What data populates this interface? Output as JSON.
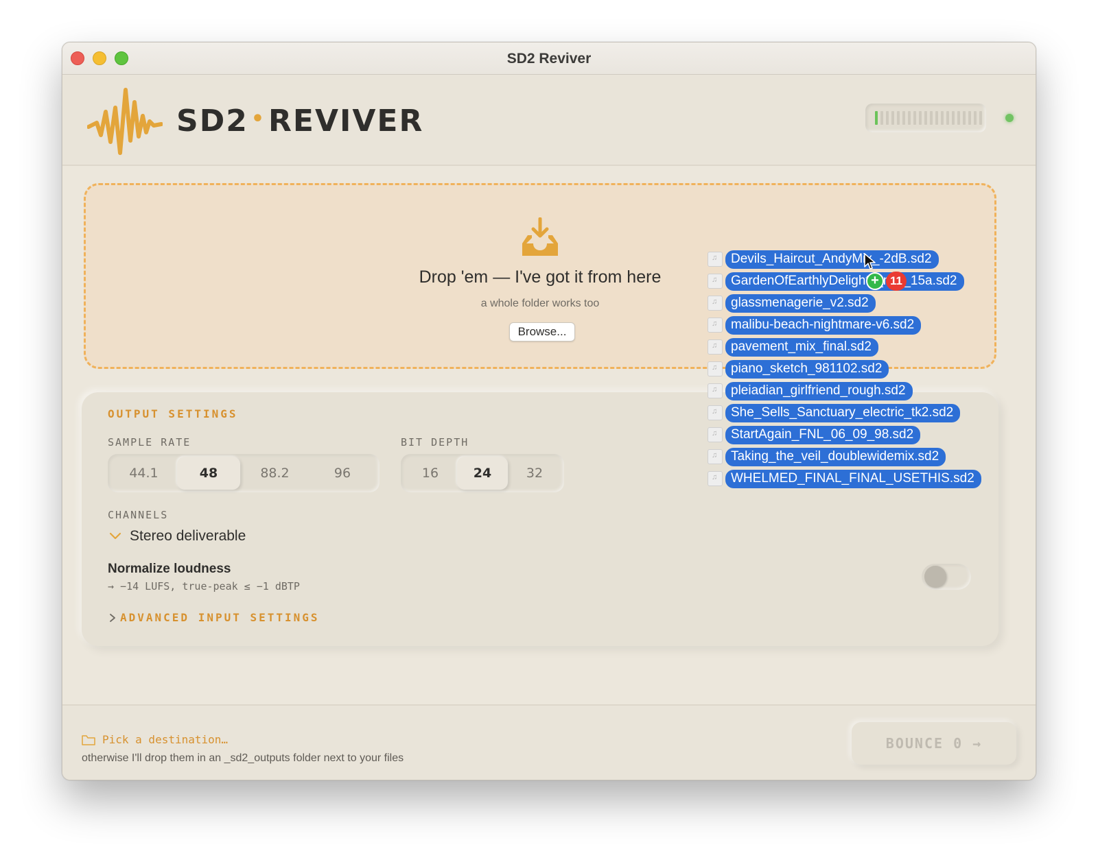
{
  "window": {
    "title": "SD2 Reviver"
  },
  "header": {
    "brand_left": "SD2",
    "brand_dot": "•",
    "brand_right": "REVIVER",
    "meter_level": 0.06,
    "status_led": "green"
  },
  "dropzone": {
    "title": "Drop 'em — I've got it from here",
    "subtitle": "a whole folder works too",
    "browse_label": "Browse..."
  },
  "settings": {
    "section_title": "OUTPUT SETTINGS",
    "sample_rate": {
      "label": "SAMPLE RATE",
      "options": [
        "44.1",
        "48",
        "88.2",
        "96"
      ],
      "selected": "48"
    },
    "bit_depth": {
      "label": "BIT DEPTH",
      "options": [
        "16",
        "24",
        "32"
      ],
      "selected": "24"
    },
    "channels": {
      "label": "CHANNELS",
      "value": "Stereo deliverable"
    },
    "normalize": {
      "title": "Normalize loudness",
      "subtitle": "→ −14 LUFS, true-peak ≤ −1 dBTP",
      "enabled": false
    },
    "advanced_label": "ADVANCED INPUT SETTINGS"
  },
  "footer": {
    "destination_label": "Pick a destination…",
    "destination_hint": "otherwise I'll drop them in an _sd2_outputs folder next to your files",
    "bounce_label": "BOUNCE 0 →"
  },
  "drag": {
    "count_badge": "11",
    "plus_badge": "+",
    "files": [
      "Devils_Haircut_AndyMix_-2dB.sd2",
      "GardenOfEarthlyDelights_mix_15a.sd2",
      "glassmenagerie_v2.sd2",
      "malibu-beach-nightmare-v6.sd2",
      "pavement_mix_final.sd2",
      "piano_sketch_981102.sd2",
      "pleiadian_girlfriend_rough.sd2",
      "She_Sells_Sanctuary_electric_tk2.sd2",
      "StartAgain_FNL_06_09_98.sd2",
      "Taking_the_veil_doublewidemix.sd2",
      "WHELMED_FINAL_FINAL_USETHIS.sd2"
    ]
  },
  "colors": {
    "accent": "#e3a53b",
    "drag_highlight": "#2d6fd6",
    "background": "#ece7dc"
  }
}
